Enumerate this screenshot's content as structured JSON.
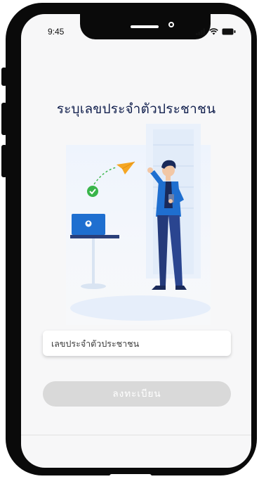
{
  "status_bar": {
    "time": "9:45",
    "icons": [
      "signal-icon",
      "wifi-icon",
      "battery-icon"
    ]
  },
  "page": {
    "title": "ระบุเลขประจำตัวประชาชน"
  },
  "form": {
    "id_input_placeholder": "เลขประจำตัวประชาชน",
    "id_input_value": "",
    "register_button_label": "ลงทะเบียน"
  },
  "colors": {
    "title": "#12204e",
    "button_disabled_bg": "#d9d9d9",
    "accent_blue": "#1f6fd0",
    "accent_orange": "#f5a623",
    "accent_green": "#39b54a"
  },
  "illustration": {
    "name": "man-with-phone-and-laptop-illustration"
  }
}
